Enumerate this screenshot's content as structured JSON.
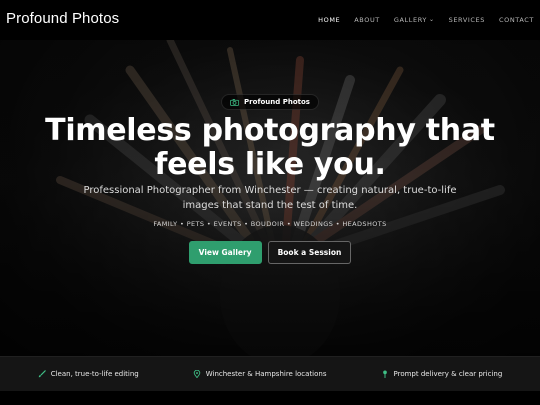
{
  "header": {
    "brand": "Profound Photos",
    "nav": [
      {
        "label": "HOME",
        "active": true
      },
      {
        "label": "ABOUT",
        "active": false
      },
      {
        "label": "GALLERY",
        "active": false,
        "has_dropdown": true
      },
      {
        "label": "SERVICES",
        "active": false
      },
      {
        "label": "CONTACT",
        "active": false
      }
    ]
  },
  "hero": {
    "badge": "Profound Photos",
    "title": "Timeless photography that feels like you.",
    "subtitle": "Professional Photographer from Winchester — creating natural, true-to-life images that stand the test of time.",
    "tags": "FAMILY • PETS • EVENTS • BOUDOIR • WEDDINGS • HEADSHOTS",
    "primary_button": "View Gallery",
    "secondary_button": "Book a Session"
  },
  "features": [
    {
      "icon": "brush-icon",
      "label": "Clean, true-to-life editing"
    },
    {
      "icon": "map-pin-icon",
      "label": "Winchester & Hampshire locations"
    },
    {
      "icon": "pin-icon",
      "label": "Prompt delivery & clear pricing"
    }
  ],
  "colors": {
    "accent": "#2f9e6e",
    "header_bg": "#000000",
    "features_bg": "#151515"
  }
}
